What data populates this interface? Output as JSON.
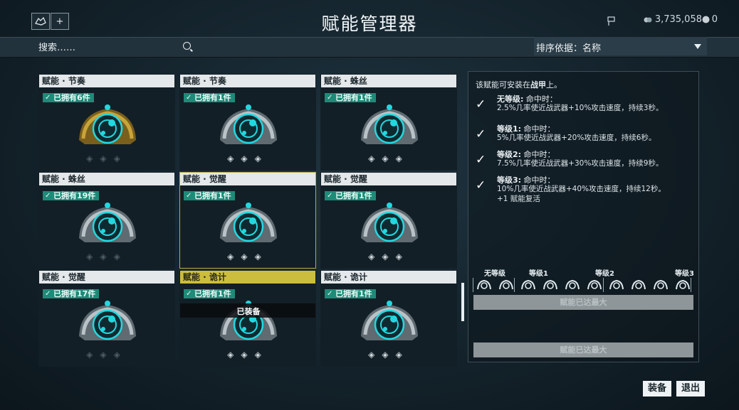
{
  "header": {
    "title": "赋能管理器",
    "credits": "3,735,058",
    "platinum": "0",
    "add_label": "+"
  },
  "search": {
    "placeholder": "搜索……"
  },
  "sort": {
    "label": "排序依据：名称"
  },
  "cards": [
    {
      "title": "赋能 · 节奏",
      "owned": "已拥有6件",
      "style": "gold",
      "ranks_filled": 0
    },
    {
      "title": "赋能 · 节奏",
      "owned": "已拥有1件",
      "style": "silver",
      "ranks_filled": 3
    },
    {
      "title": "赋能 · 蛛丝",
      "owned": "已拥有1件",
      "style": "silver",
      "ranks_filled": 3
    },
    {
      "title": "赋能 · 蛛丝",
      "owned": "已拥有19件",
      "style": "silver",
      "ranks_filled": 0
    },
    {
      "title": "赋能 · 觉醒",
      "owned": "已拥有1件",
      "style": "silver",
      "ranks_filled": 3,
      "selected": true
    },
    {
      "title": "赋能 · 觉醒",
      "owned": "已拥有1件",
      "style": "silver",
      "ranks_filled": 3
    },
    {
      "title": "赋能 · 觉醒",
      "owned": "已拥有17件",
      "style": "silver",
      "ranks_filled": 0
    },
    {
      "title": "赋能 · 诡计",
      "owned": "已拥有1件",
      "style": "silver",
      "ranks_filled": 3,
      "equipped": "已装备",
      "gold_title": true
    },
    {
      "title": "赋能 · 诡计",
      "owned": "已拥有1件",
      "style": "silver",
      "ranks_filled": 2
    }
  ],
  "detail": {
    "hint_pre": "该赋能可安装在",
    "hint_bold": "战甲",
    "hint_post": "上。",
    "ranks": [
      {
        "name": "无等级:",
        "cond": " 命中时：",
        "effect": "2.5%几率使近战武器+10%攻击速度，持续3秒。"
      },
      {
        "name": "等级1:",
        "cond": " 命中时：",
        "effect": "5%几率使近战武器+20%攻击速度，持续6秒。"
      },
      {
        "name": "等级2:",
        "cond": " 命中时：",
        "effect": "7.5%几率使近战武器+30%攻击速度，持续9秒。"
      },
      {
        "name": "等级3:",
        "cond": " 命中时：",
        "effect": "10%几率使近战武器+40%攻击速度，持续12秒。",
        "extra": "+1 赋能复活"
      }
    ],
    "tier_labels": [
      "无等级",
      "等级1",
      "等级2",
      "等级3"
    ],
    "max_button_1": "赋能已达最大",
    "max_button_2": "赋能已达最大"
  },
  "actions": {
    "equip": "装备",
    "exit": "退出"
  },
  "colors": {
    "accent_cyan": "#22d8e0",
    "owned_badge": "#1e8a78",
    "selected_border": "#b9ad3a"
  }
}
